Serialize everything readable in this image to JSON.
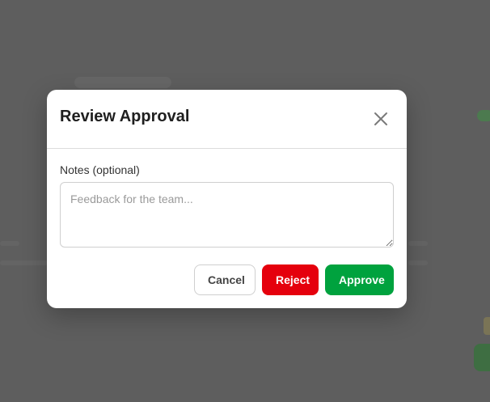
{
  "dialog": {
    "title": "Review Approval",
    "close_icon": "close-icon"
  },
  "notes": {
    "label": "Notes (optional)",
    "value": "",
    "placeholder": "Feedback for the team..."
  },
  "actions": {
    "cancel_label": "Cancel",
    "reject_label": "Reject",
    "approve_label": "Approve"
  },
  "colors": {
    "overlay": "#5e5e5e",
    "reject": "#e5000d",
    "approve": "#00a23e"
  }
}
